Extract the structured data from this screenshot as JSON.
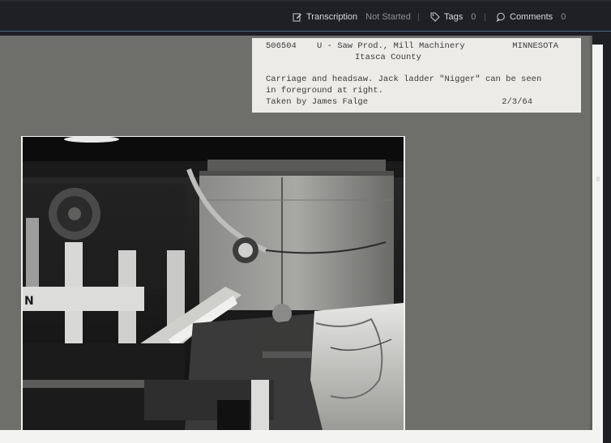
{
  "toolbar": {
    "transcription_label": "Transcription",
    "transcription_status": "Not Started",
    "tags_label": "Tags",
    "tags_count": "0",
    "comments_label": "Comments",
    "comments_count": "0"
  },
  "card": {
    "id": "506504",
    "category": "U - Saw Prod., Mill Machinery",
    "state": "MINNESOTA",
    "county": "Itasca County",
    "caption_line1": "Carriage and headsaw.  Jack ladder \"Nigger\" can be seen",
    "caption_line2": "in foreground at right.",
    "photographer": "Taken by James Falge",
    "date": "2/3/64"
  },
  "photo": {
    "description_alt": "Black and white photograph of sawmill carriage and headsaw"
  },
  "colors": {
    "accent": "#2f6fb0",
    "board": "#6e6e6b",
    "label_paper": "#ecebe6"
  }
}
